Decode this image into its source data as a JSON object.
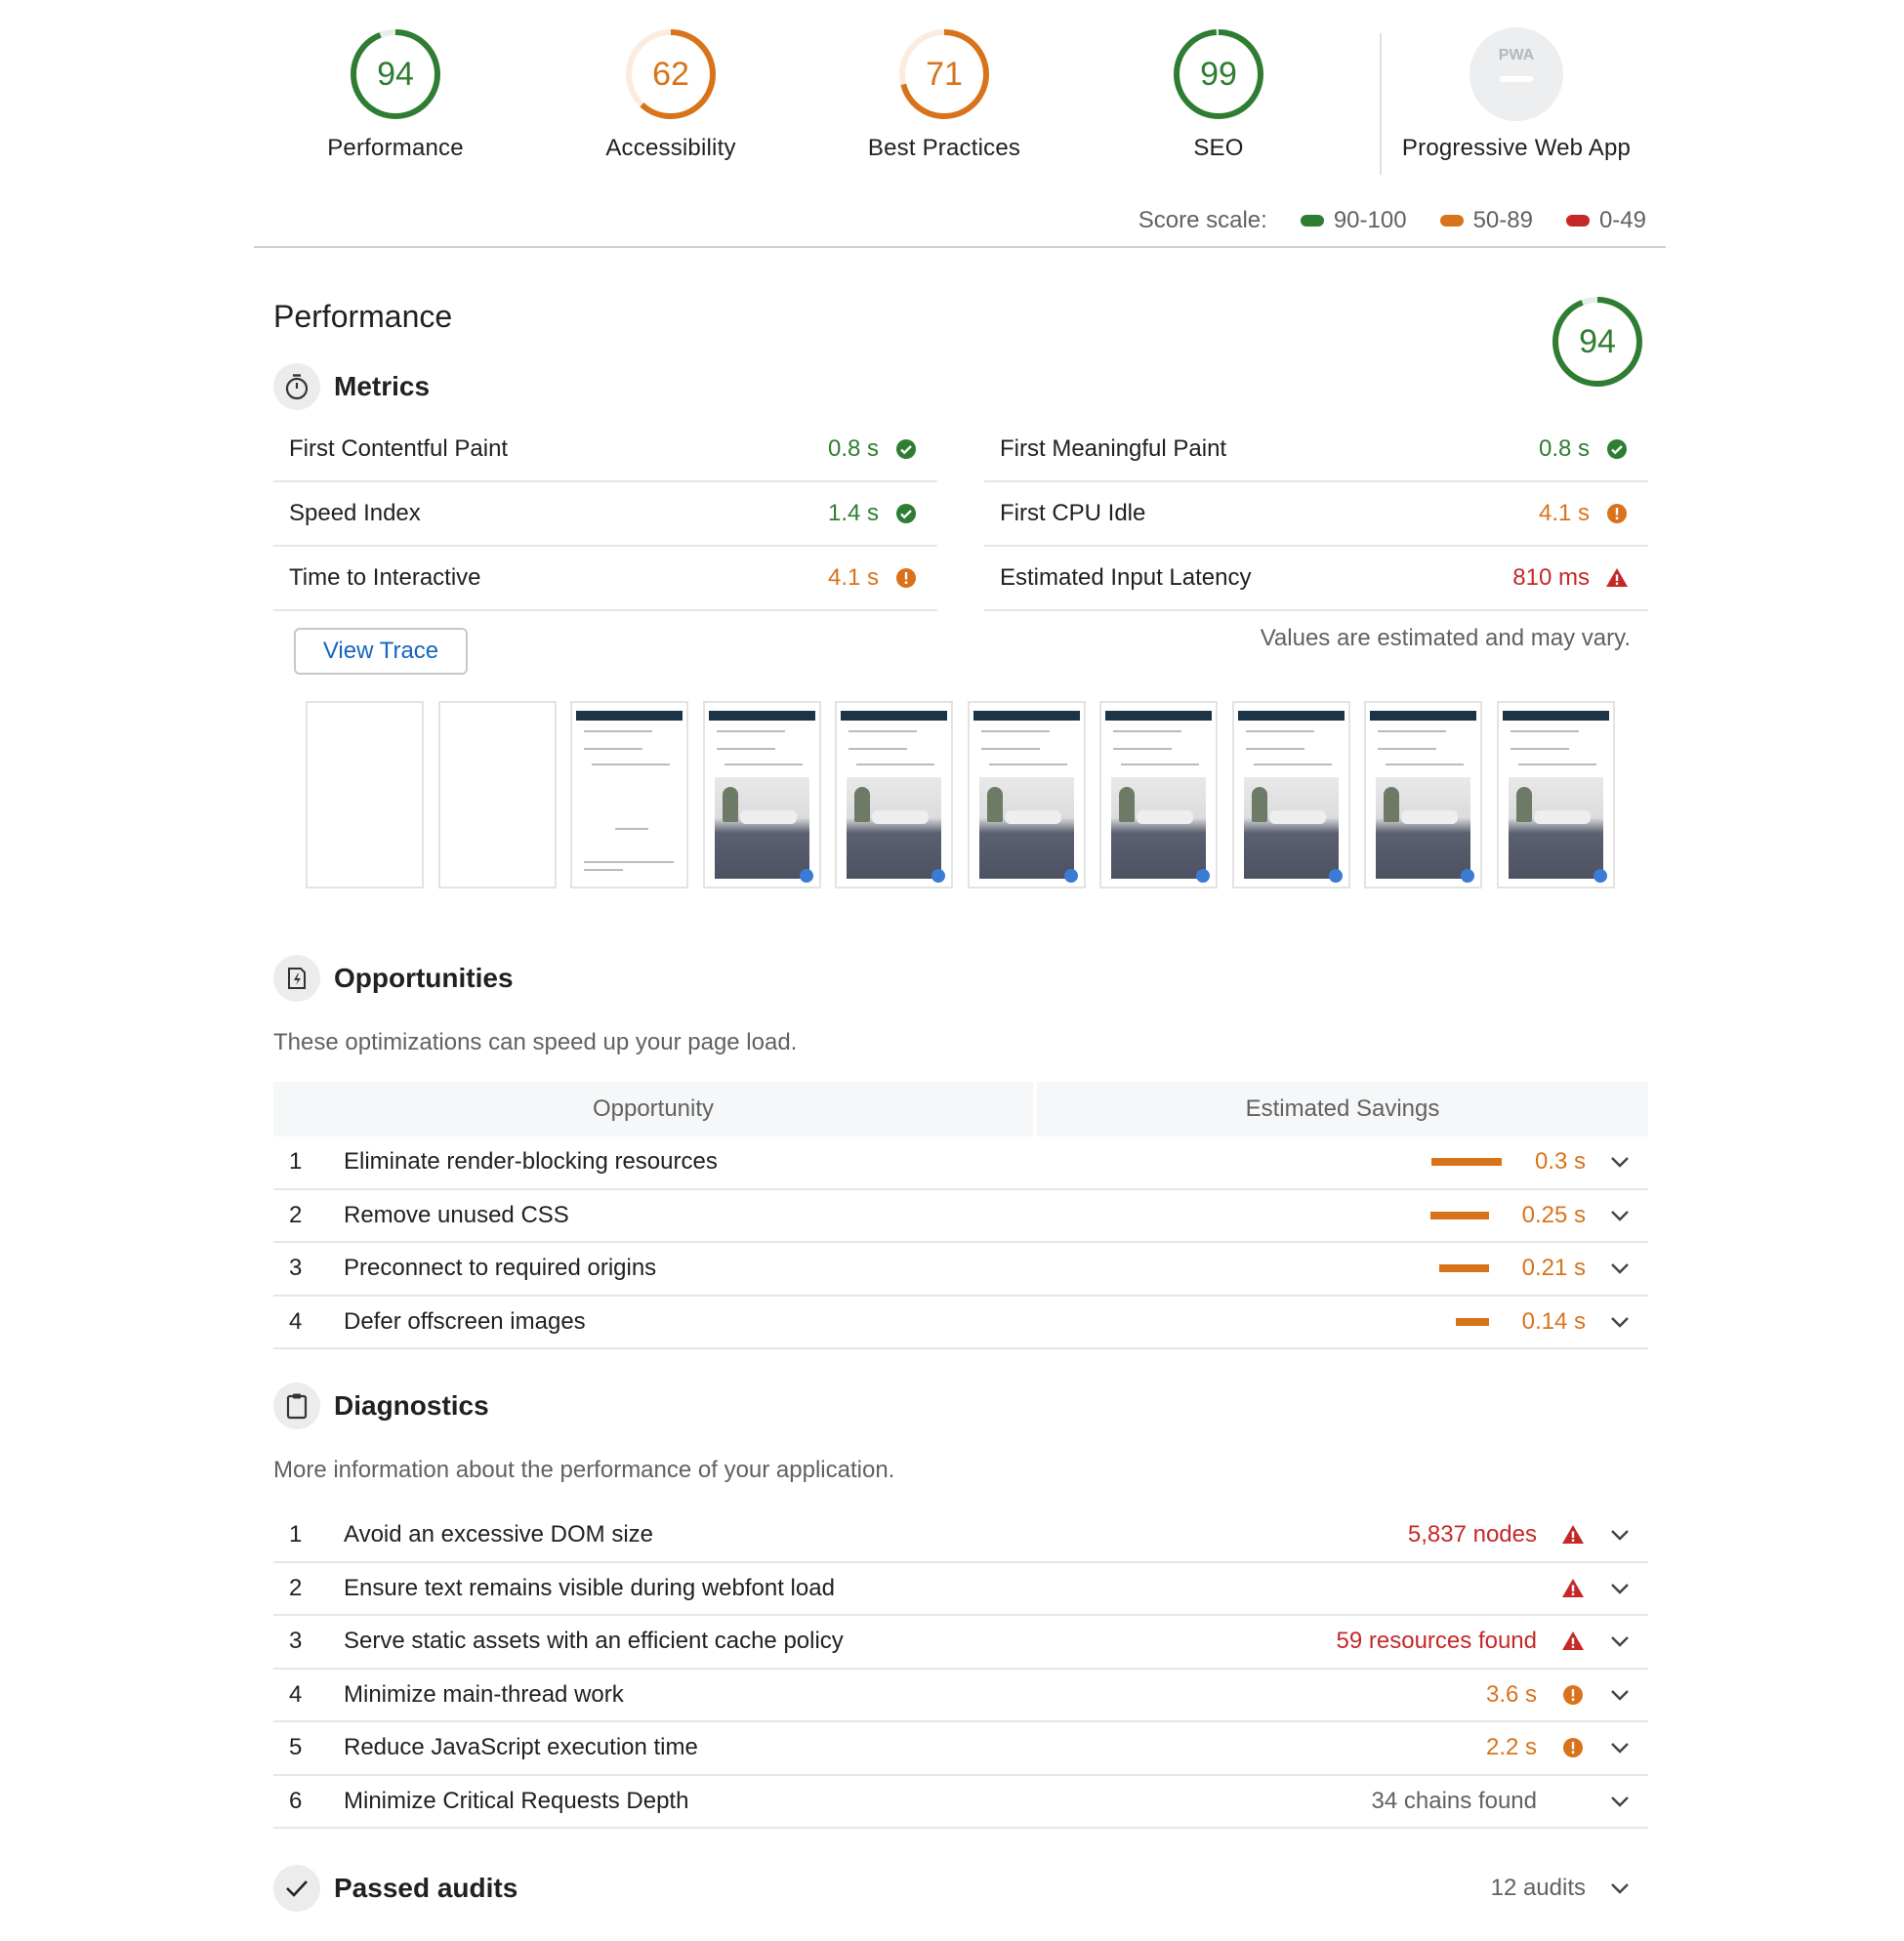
{
  "gauges": [
    {
      "label": "Performance",
      "score": "94",
      "value": 94,
      "color": "#2f7d32"
    },
    {
      "label": "Accessibility",
      "score": "62",
      "value": 62,
      "color": "#d9731b"
    },
    {
      "label": "Best Practices",
      "score": "71",
      "value": 71,
      "color": "#d9731b"
    },
    {
      "label": "SEO",
      "score": "99",
      "value": 99,
      "color": "#2f7d32"
    },
    {
      "label": "Progressive Web App",
      "badge": "PWA"
    }
  ],
  "score_scale": {
    "label": "Score scale:",
    "ranges": [
      {
        "label": "90-100",
        "color": "#2f7d32"
      },
      {
        "label": "50-89",
        "color": "#d9731b"
      },
      {
        "label": "0-49",
        "color": "#c62828"
      }
    ]
  },
  "performance": {
    "title": "Performance",
    "score": "94",
    "value": 94,
    "metrics_title": "Metrics",
    "metrics": [
      {
        "label": "First Contentful Paint",
        "value": "0.8 s",
        "status": "pass"
      },
      {
        "label": "First Meaningful Paint",
        "value": "0.8 s",
        "status": "pass"
      },
      {
        "label": "Speed Index",
        "value": "1.4 s",
        "status": "pass"
      },
      {
        "label": "First CPU Idle",
        "value": "4.1 s",
        "status": "average"
      },
      {
        "label": "Time to Interactive",
        "value": "4.1 s",
        "status": "average"
      },
      {
        "label": "Estimated Input Latency",
        "value": "810 ms",
        "status": "fail"
      }
    ],
    "view_trace_label": "View Trace",
    "estimate_note": "Values are estimated and may vary."
  },
  "opportunities": {
    "title": "Opportunities",
    "description": "These optimizations can speed up your page load.",
    "col_opportunity": "Opportunity",
    "col_savings": "Estimated Savings",
    "rows": [
      {
        "num": "1",
        "title": "Eliminate render-blocking resources",
        "savings": "0.3 s",
        "seconds": 0.3
      },
      {
        "num": "2",
        "title": "Remove unused CSS",
        "savings": "0.25 s",
        "seconds": 0.25
      },
      {
        "num": "3",
        "title": "Preconnect to required origins",
        "savings": "0.21 s",
        "seconds": 0.21
      },
      {
        "num": "4",
        "title": "Defer offscreen images",
        "savings": "0.14 s",
        "seconds": 0.14
      }
    ]
  },
  "diagnostics": {
    "title": "Diagnostics",
    "description": "More information about the performance of your application.",
    "rows": [
      {
        "num": "1",
        "title": "Avoid an excessive DOM size",
        "value": "5,837 nodes",
        "status": "fail"
      },
      {
        "num": "2",
        "title": "Ensure text remains visible during webfont load",
        "value": "",
        "status": "fail"
      },
      {
        "num": "3",
        "title": "Serve static assets with an efficient cache policy",
        "value": "59 resources found",
        "status": "fail"
      },
      {
        "num": "4",
        "title": "Minimize main-thread work",
        "value": "3.6 s",
        "status": "average"
      },
      {
        "num": "5",
        "title": "Reduce JavaScript execution time",
        "value": "2.2 s",
        "status": "average"
      },
      {
        "num": "6",
        "title": "Minimize Critical Requests Depth",
        "value": "34 chains found",
        "status": "info"
      }
    ]
  },
  "passed": {
    "title": "Passed audits",
    "count": "12 audits"
  },
  "icons": {
    "metrics": "stopwatch-icon",
    "opportunities": "lightning-page-icon",
    "diagnostics": "clipboard-icon",
    "passed": "checkmark-icon",
    "expand": "chevron-down-icon"
  },
  "colors": {
    "pass": "#2f7d32",
    "average": "#d9731b",
    "fail": "#c62828",
    "info": "#616161"
  }
}
